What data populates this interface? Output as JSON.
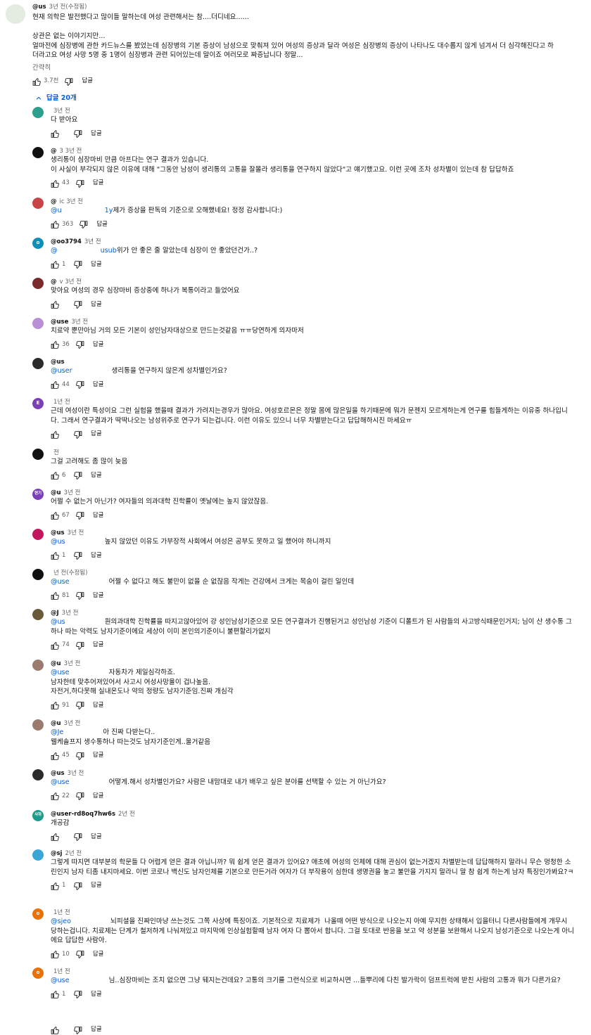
{
  "top_comment": {
    "handle": "@us",
    "time": "3년 전(수정됨)",
    "lines": [
      "현재 의학은 발전했다고 많이들 말하는데 여성 관련해서는 참....더디네요......",
      "",
      "상관은 없는 이야기지만...",
      "얼마전에 심장병에 관한 카드뉴스를 봤었는데 심장병의 기본 증상이 남성으로 맞춰져 있어 여성의 증상과 달라 여성은 심장병의 증상이 나타나도 대수롭지 않게 넘겨서 더 심각해진다고 하",
      "더라고요 여성 사망 5명 중 1명이 심장병과 관련 되어있는데 말이죠 여러모로 짜증납니다 정말..."
    ],
    "more_label": "간략히",
    "likes": "3.7천",
    "reply_label": "답글"
  },
  "replies_toggle": {
    "label": "답글 20개"
  },
  "replies": [
    {
      "handle": "",
      "time": "3년 전",
      "mention": "",
      "text": "다 받아요",
      "likes": "",
      "reply_label": "답글",
      "avatar_color": "#2e9e8e",
      "avatar_letter": ""
    },
    {
      "handle": "@",
      "time": "3 3년 전",
      "mention": "",
      "text": "생리통이 심장마비 만큼 아프다는 연구 결과가 있습니다.\n이 사실이 부각되지 않은 이유에 대해 \"그동안 남성이 생리통의 고통을 잘몰라 생리통을 연구하지 않았다\"고 얘기했고요. 이런 곳에 조차 성차별이 있는데 참 답답하죠",
      "likes": "43",
      "reply_label": "답글",
      "avatar_color": "#111111",
      "avatar_letter": ""
    },
    {
      "handle": "@",
      "time": "ic 3년 전",
      "mention": "@u                    1y",
      "text": "제가 증상을 판독의 기준으로 오해했네요! 정정 감사합니다:)",
      "likes": "363",
      "reply_label": "답글",
      "avatar_color": "#c94545",
      "avatar_letter": ""
    },
    {
      "handle": "@oo3794",
      "time": "3년 전",
      "mention": "@                    usub",
      "text": "위가 안 좋은 줄 알았는데 심장이 안 좋았던건가..?",
      "likes": "1",
      "reply_label": "답글",
      "avatar_color": "#0f8fb8",
      "avatar_letter": "o"
    },
    {
      "handle": "@",
      "time": "v 3년 전",
      "mention": "",
      "text": "맞아요 여성의 경우 심장마비 증상중에 하나가 복통이라고 들었어요",
      "likes": "",
      "reply_label": "답글",
      "avatar_color": "#7a2c2c",
      "avatar_letter": ""
    },
    {
      "handle": "@use",
      "time": "3년 전",
      "mention": "",
      "text": "치료약 뿐만아님 거의 모든 기본이 성인남자대상으로 만드는것같음 ㅠㅠ당연하게 의자마저",
      "likes": "36",
      "reply_label": "답글",
      "avatar_color": "#b98fd8",
      "avatar_letter": ""
    },
    {
      "handle": "@us",
      "time": "",
      "mention": "@user",
      "text": "생리통을 연구하지 않은게 성차별인가요?",
      "likes": "44",
      "reply_label": "답글",
      "avatar_color": "#2b2b2b",
      "avatar_letter": ""
    },
    {
      "handle": "",
      "time": "1년 전",
      "mention": "",
      "text": "근데 여성이란 특성이요 그런 실험을 했을때 결과가 가려지는경우가 많아요. 여성호르몬은 정말 몸에 많은일을 하기때문에 뭐가 문젠지 모르게하는게 연구를 힘들게하는 이유중 하나입니다. 그래서 연구결과가 딱딱나오는 남성위주로 연구가 되는겁니다. 이런 이유도 있으니 너무 차별받는다고 답답해하시진 마세요ㅠ",
      "likes": "",
      "reply_label": "답글",
      "avatar_color": "#7b3fb8",
      "avatar_letter": "E"
    },
    {
      "handle": "",
      "time": "전",
      "mention": "",
      "text": "그걸 고려해도 좀 많이 늦음",
      "likes": "6",
      "reply_label": "답글",
      "avatar_color": "#111111",
      "avatar_letter": ""
    },
    {
      "handle": "@u",
      "time": "3년 전",
      "mention": "",
      "text": "어쩔 수 없는거 아닌가? 여자들의 의과대학 진학률이 옛날에는 높지 않았잖음.",
      "likes": "67",
      "reply_label": "답글",
      "avatar_color": "#7b3fb8",
      "avatar_letter": "현기"
    },
    {
      "handle": "@us",
      "time": "3년 전",
      "mention": "@us",
      "text": "높지 않았던 이유도 가부장적 사회에서 여성은 공부도 못하고 일 했어야 하니까지",
      "likes": "1",
      "reply_label": "답글",
      "avatar_color": "#c2185b",
      "avatar_letter": ""
    },
    {
      "handle": "",
      "time": "년 전(수정됨)",
      "mention": "@use",
      "text": "어쩔 수 없다고 해도 불만이 없을 순 없잖음 작게는 건강에서 크게는 목숨이 걸린 일인데",
      "likes": "81",
      "reply_label": "답글",
      "avatar_color": "#111111",
      "avatar_letter": ""
    },
    {
      "handle": "@J",
      "time": "3년 전",
      "mention": "@us",
      "text": "원의과대학 진학률을 따지고않아있어 걍 성인남성기준으로 모든 연구결과가 진행된거고 성인남성 기준이 디폴트가 된 사람들의 사고방식때문인거지; 님이 산 생수통 그하나 따는 악력도 남자기준이에요 세상이 이미 본인의기준이니 불편할리가없지",
      "likes": "74",
      "reply_label": "답글",
      "avatar_color": "#6b5a3a",
      "avatar_letter": ""
    },
    {
      "handle": "@u",
      "time": "3년 전",
      "mention": "@use",
      "text": "자동차가 제일심각하죠.\n남자한테 맞추어져있어서 사고시 여성사망율이 겁나높음.\n자전거,하다못해 실내온도나 약의 정량도 남자기준임.진짜 개심각",
      "likes": "91",
      "reply_label": "답글",
      "avatar_color": "#9a7b6e",
      "avatar_letter": ""
    },
    {
      "handle": "@u",
      "time": "3년 전",
      "mention": "@Je",
      "text": "아 진짜 다받는다..\n웰케솔프지 생수통하나 따는것도 남자기준인게..울거같음",
      "likes": "45",
      "reply_label": "답글",
      "avatar_color": "#9a7b6e",
      "avatar_letter": ""
    },
    {
      "handle": "@us",
      "time": "3년 전",
      "mention": "@use",
      "text": "어떻게.해서 성차별인가요? 사람은 내맘대로 내가 배우고 싶은 분야를 선택할 수 있는 거 아닌가요?",
      "likes": "22",
      "reply_label": "답글",
      "avatar_color": "#2b2b2b",
      "avatar_letter": ""
    },
    {
      "handle": "@user-rd8oq7hw6s",
      "time": "2년 전",
      "mention": "",
      "text": "개공감",
      "likes": "",
      "reply_label": "답글",
      "avatar_color": "#1e9b8a",
      "avatar_letter": "사하"
    },
    {
      "handle": "@sj",
      "time": "2년 전",
      "mention": "",
      "text": "그렇게 따지면 대부분의 학문들 다 어렵게 얻은 결과 아닙니까? 뭐 쉽게 얻은 결과가 있어요? 애초에 여성의 인체에 대해 관심이 없는거겠지 차별받는데 답답해하지 말라니 무슨 멍청한 소린인지 남자 티좀 내지마세요. 이번 코로나 백신도 남자인체를 기본으로 만든거라 여자가 더 부작용이 심한데 생명권을 놓고 불만을 가지지 말라니 말 참 쉽게 하는게 남자 특징인가봐요?ㅋ",
      "likes": "1",
      "reply_label": "답글",
      "avatar_color": "#3aa6d6",
      "avatar_letter": ""
    },
    {
      "handle": "",
      "time": "1년 전",
      "mention": "@sjeo",
      "text": "뇌피셜을 진짜인마냥 쓰는것도 그쪽 사상에 특징이죠. 기본적으로 치료제가  나올때 어떤 방식으로 나오는지 아예 무지한 상태해서 입을터니 다른사람들에게 개무시 당하는겁니다. 치료제는 단계가 철저하게 나눠져있고 마지막에 인상실험할때 남자 여자 다 뽑아서 합니다. 그걸 토대로 반응을 보고 약 성분을 보완해서 나오지 남성기준으로 나오는게 아니에요 답답한 사람아.",
      "likes": "10",
      "reply_label": "답글",
      "avatar_color": "#e8710a",
      "avatar_letter": "o"
    },
    {
      "handle": "",
      "time": "1년 전",
      "mention": "@use",
      "text": "님..심장마비는 조치 없으면 그냥 뒈지는건데요? 고통의 크기를 그런식으로 비교하시면 ...들뿌리에 다친 발가락이 덤프트럭에 받친 사람의 고통과 뭐가 다른가요?",
      "likes": "1",
      "reply_label": "답글",
      "avatar_color": "#e8710a",
      "avatar_letter": "o"
    },
    {
      "handle": "",
      "time": "",
      "mention": "",
      "text": "",
      "likes": "",
      "reply_label": "답글",
      "avatar_color": "#ffffff",
      "avatar_letter": ""
    }
  ]
}
